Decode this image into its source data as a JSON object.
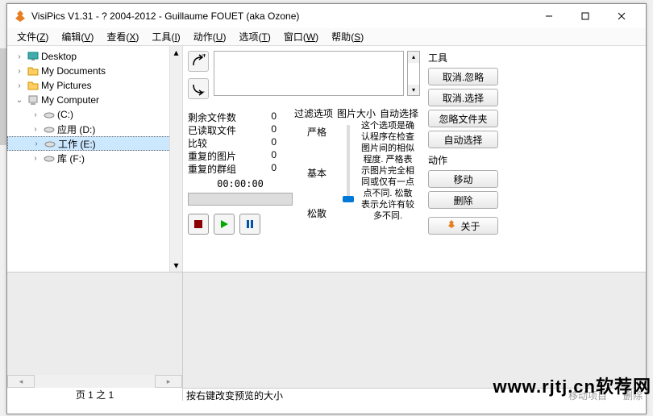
{
  "title": "VisiPics V1.31 - ? 2004-2012 - Guillaume FOUET (aka Ozone)",
  "menus": [
    {
      "label": "文件",
      "accel": "Z"
    },
    {
      "label": "编辑",
      "accel": "V"
    },
    {
      "label": "查看",
      "accel": "X"
    },
    {
      "label": "工具",
      "accel": "I"
    },
    {
      "label": "动作",
      "accel": "U"
    },
    {
      "label": "选项",
      "accel": "T"
    },
    {
      "label": "窗口",
      "accel": "W"
    },
    {
      "label": "帮助",
      "accel": "S"
    }
  ],
  "tree": {
    "desktop": "Desktop",
    "mydocs": "My Documents",
    "mypics": "My Pictures",
    "mycomp": "My Computer",
    "drives": [
      {
        "label": "(C:)"
      },
      {
        "label": "应用 (D:)"
      },
      {
        "label": "工作 (E:)",
        "selected": true
      },
      {
        "label": "库 (F:)"
      }
    ]
  },
  "stats": {
    "remain_label": "剩余文件数",
    "remain_val": "0",
    "read_label": "已读取文件",
    "read_val": "0",
    "cmp_label": "比较",
    "cmp_val": "0",
    "dup_label": "重复的图片",
    "dup_val": "0",
    "grp_label": "重复的群组",
    "grp_val": "0"
  },
  "filter": {
    "title": "过滤选项",
    "pic_size": "图片大小",
    "auto_sel": "自动选择",
    "strict": "严格",
    "basic": "基本",
    "loose": "松散"
  },
  "desc_text": "这个选项是确认程序在检查图片间的相似程度. 严格表示图片完全相同或仅有一点点不同. 松散表示允许有较多不同.",
  "timer": "00:00:00",
  "right": {
    "tools": "工具",
    "cancel_ignore": "取消.忽略",
    "cancel_select": "取消.选择",
    "ignore_folder": "忽略文件夹",
    "auto_select": "自动选择",
    "actions": "动作",
    "move": "移动",
    "delete": "删除",
    "about": "关于"
  },
  "pager": "页 1 之 1",
  "status_left": "按右键改变预览的大小",
  "status_right_a": "移动项目",
  "status_right_b": "删除",
  "watermark": "www.rjtj.cn软荐网"
}
